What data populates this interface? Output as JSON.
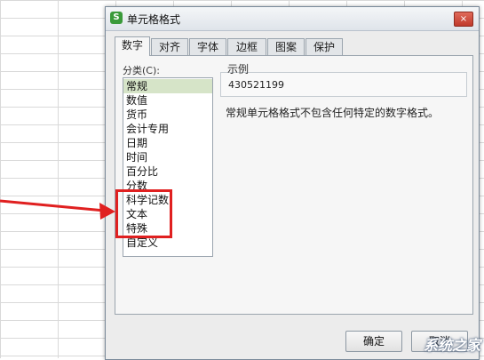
{
  "window": {
    "icon_text": "S",
    "title": "单元格格式",
    "close_symbol": "×"
  },
  "tabs": [
    {
      "label": "数字",
      "active": true
    },
    {
      "label": "对齐",
      "active": false
    },
    {
      "label": "字体",
      "active": false
    },
    {
      "label": "边框",
      "active": false
    },
    {
      "label": "图案",
      "active": false
    },
    {
      "label": "保护",
      "active": false
    }
  ],
  "category": {
    "label": "分类(C):",
    "items": [
      "常规",
      "数值",
      "货币",
      "会计专用",
      "日期",
      "时间",
      "百分比",
      "分数",
      "科学记数",
      "文本",
      "特殊",
      "自定义"
    ],
    "selected": "常规"
  },
  "sample": {
    "label": "示例",
    "value": "430521199"
  },
  "description": "常规单元格格式不包含任何特定的数字格式。",
  "buttons": {
    "ok": "确定",
    "cancel": "取消"
  },
  "watermark": "系统之家",
  "colors": {
    "highlight": "#e02020",
    "selected_item": "#d6e4c8",
    "app_icon": "#3a9a3a"
  }
}
